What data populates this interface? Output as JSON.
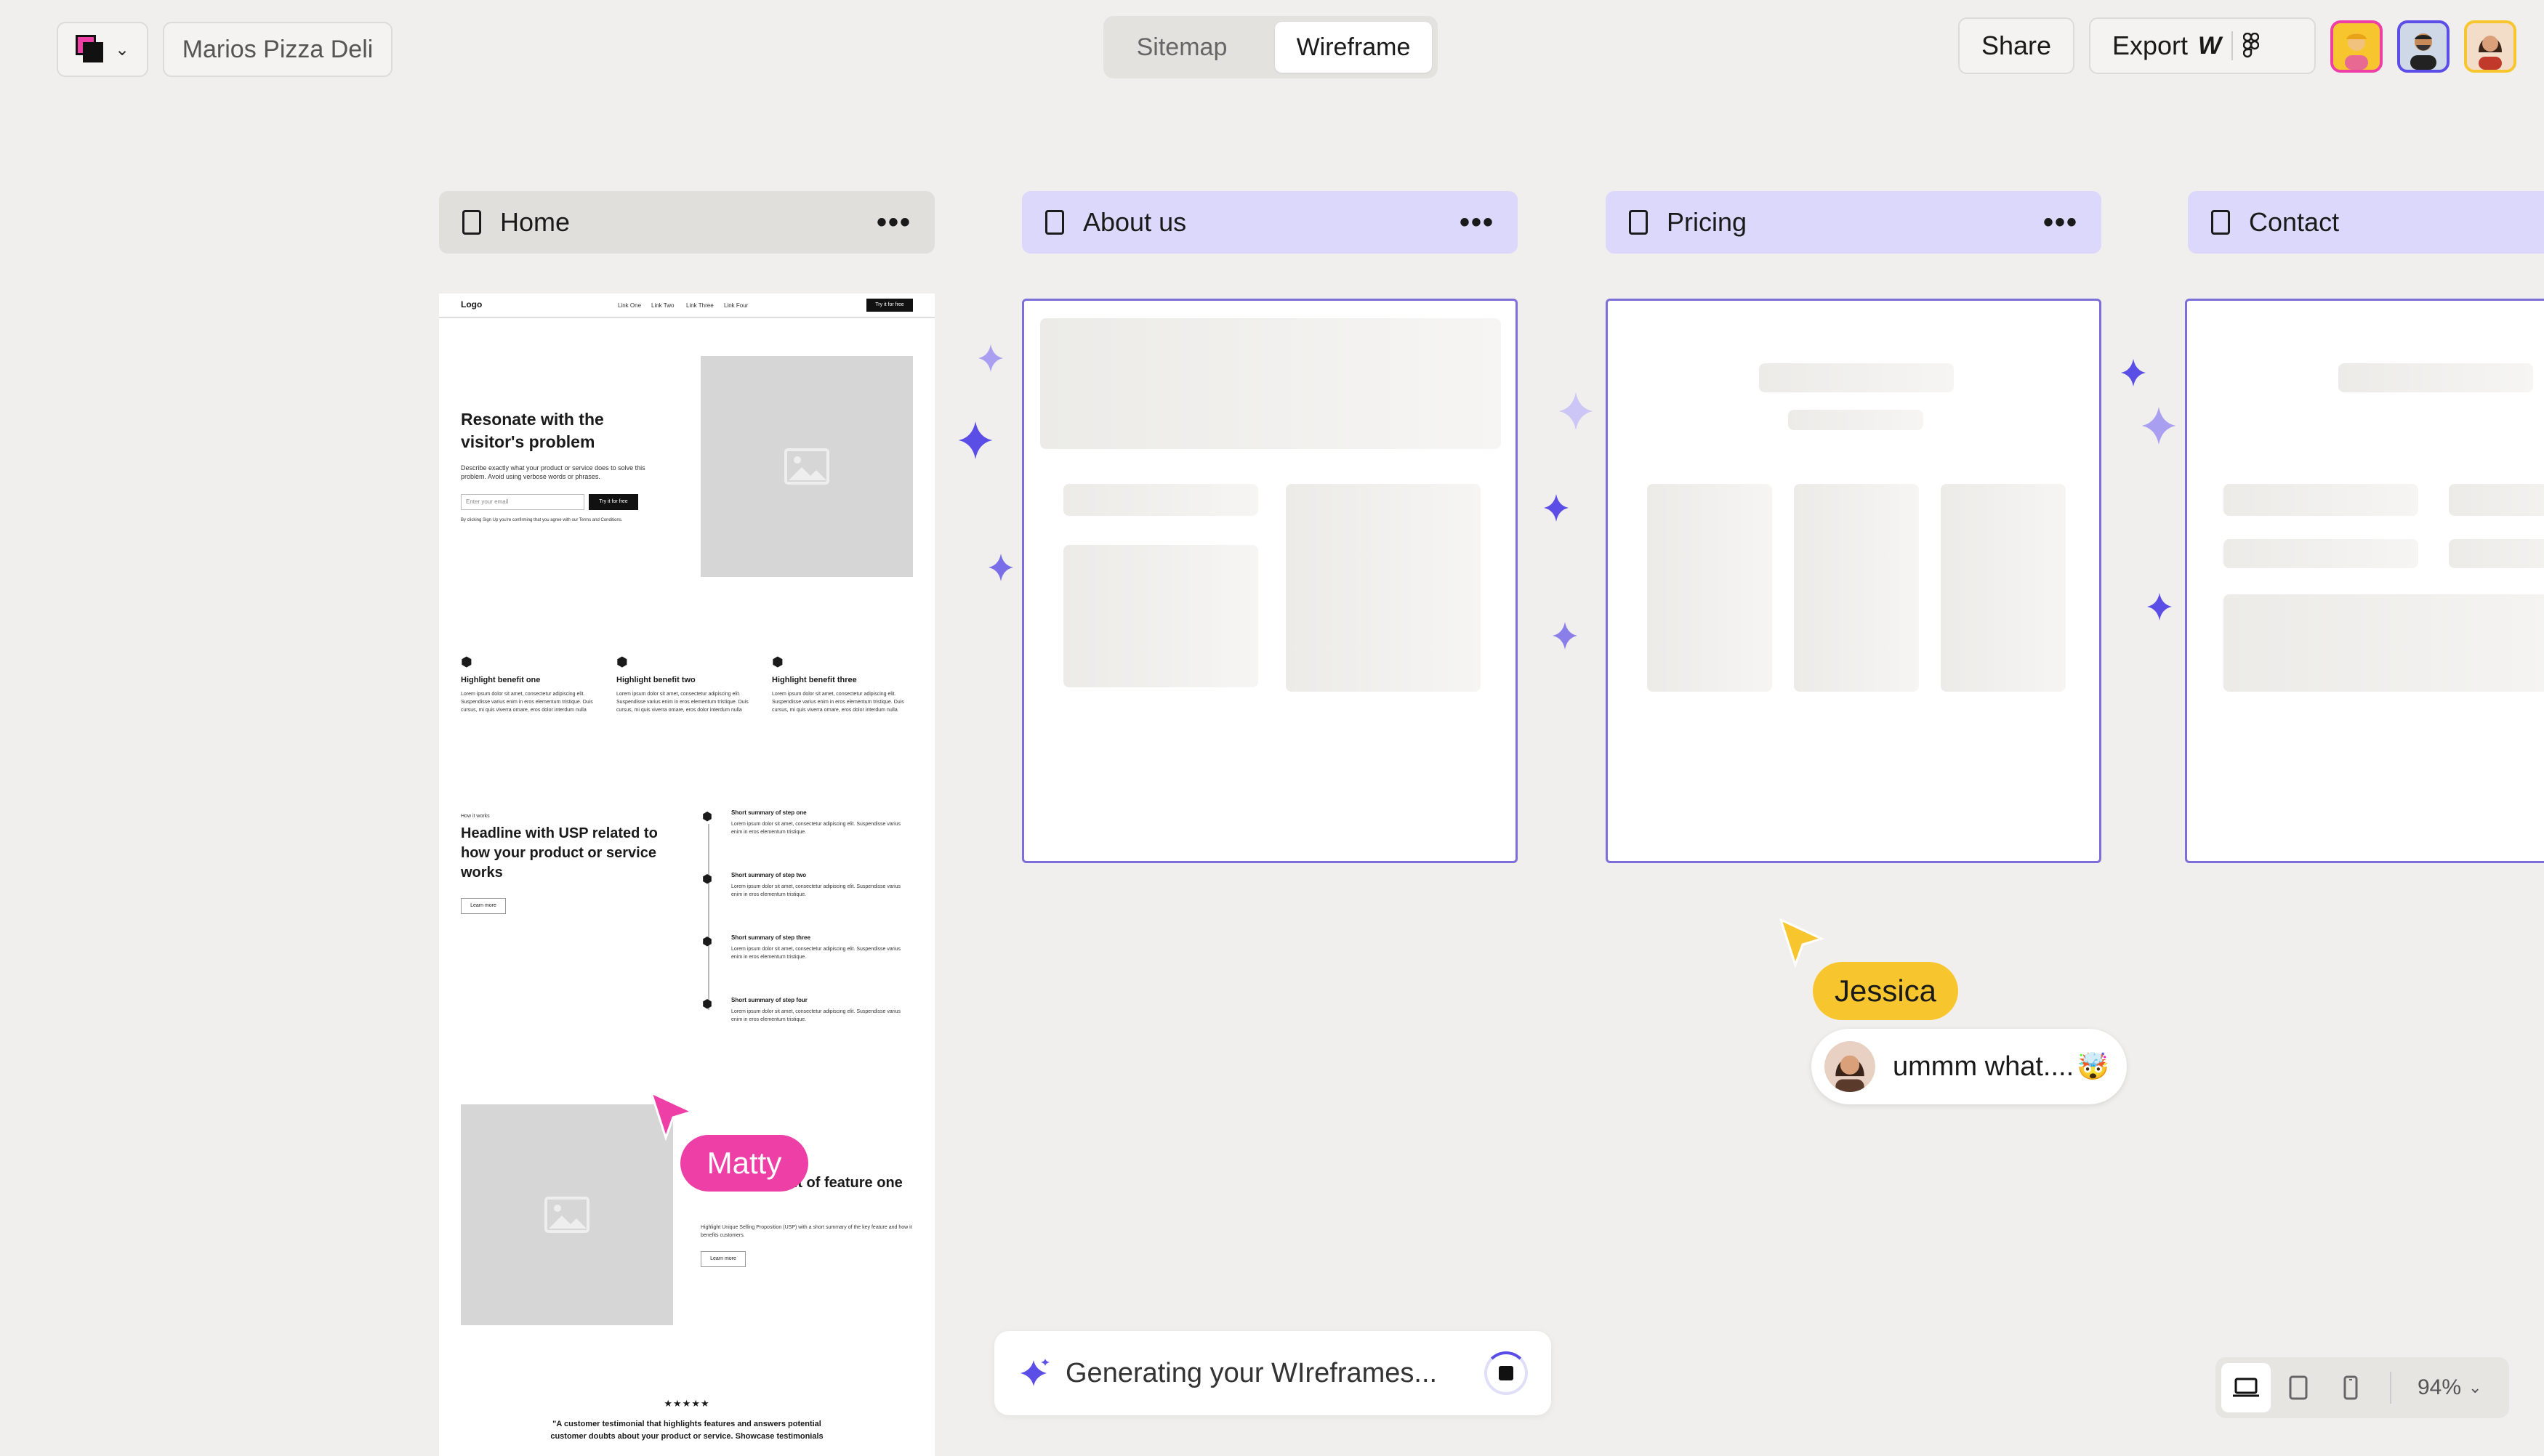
{
  "topbar": {
    "project_name": "Marios Pizza Deli",
    "tabs": [
      "Sitemap",
      "Wireframe"
    ],
    "active_tab": "Wireframe",
    "share_label": "Share",
    "export_label": "Export"
  },
  "pages": [
    {
      "label": "Home"
    },
    {
      "label": "About us"
    },
    {
      "label": "Pricing"
    },
    {
      "label": "Contact"
    }
  ],
  "home_wireframe": {
    "nav_logo": "Logo",
    "nav_links": [
      "Link One",
      "Link Two",
      "Link Three",
      "Link Four"
    ],
    "nav_cta": "Try it for free",
    "hero_title": "Resonate with the visitor's problem",
    "hero_desc": "Describe exactly what your product or service does to solve this problem. Avoid using verbose words or phrases.",
    "email_placeholder": "Enter your email",
    "hero_cta": "Try it for free",
    "hero_terms": "By clicking Sign Up you're confirming that you agree with our Terms and Conditions.",
    "benefits": [
      {
        "title": "Highlight benefit one",
        "text": "Lorem ipsum dolor sit amet, consectetur adipiscing elit. Suspendisse varius enim in eros elementum tristique. Duis cursus, mi quis viverra ornare, eros dolor interdum nulla"
      },
      {
        "title": "Highlight benefit two",
        "text": "Lorem ipsum dolor sit amet, consectetur adipiscing elit. Suspendisse varius enim in eros elementum tristique. Duis cursus, mi quis viverra ornare, eros dolor interdum nulla"
      },
      {
        "title": "Highlight benefit three",
        "text": "Lorem ipsum dolor sit amet, consectetur adipiscing elit. Suspendisse varius enim in eros elementum tristique. Duis cursus, mi quis viverra ornare, eros dolor interdum nulla"
      }
    ],
    "how_eyebrow": "How it works",
    "how_title": "Headline with USP related to how your product or service works",
    "how_button": "Learn more",
    "steps": [
      {
        "title": "Short summary of step one",
        "text": "Lorem ipsum dolor sit amet, consectetur adipiscing elit. Suspendisse varius enim in eros elementum tristique."
      },
      {
        "title": "Short summary of step two",
        "text": "Lorem ipsum dolor sit amet, consectetur adipiscing elit. Suspendisse varius enim in eros elementum tristique."
      },
      {
        "title": "Short summary of step three",
        "text": "Lorem ipsum dolor sit amet, consectetur adipiscing elit. Suspendisse varius enim in eros elementum tristique."
      },
      {
        "title": "Short summary of step four",
        "text": "Lorem ipsum dolor sit amet, consectetur adipiscing elit. Suspendisse varius enim in eros elementum tristique."
      }
    ],
    "feature_title": "efit of feature one",
    "feature_desc": "Highlight Unique Selling Proposition (USP) with a short summary of the key feature and how it benefits customers.",
    "feature_button": "Learn more",
    "stars": "★★★★★",
    "testimonial": "\"A customer testimonial that highlights features and answers potential customer doubts about your product or service. Showcase testimonials"
  },
  "collaborators": {
    "matty": "Matty",
    "jessica": "Jessica",
    "jessica_comment": "ummm what....",
    "colors": {
      "matty": "#ee3fa6",
      "jessica": "#f7c62f",
      "accent": "#5b4ee6"
    }
  },
  "generation": {
    "status": "Generating your WIreframes..."
  },
  "view_controls": {
    "zoom": "94%"
  }
}
